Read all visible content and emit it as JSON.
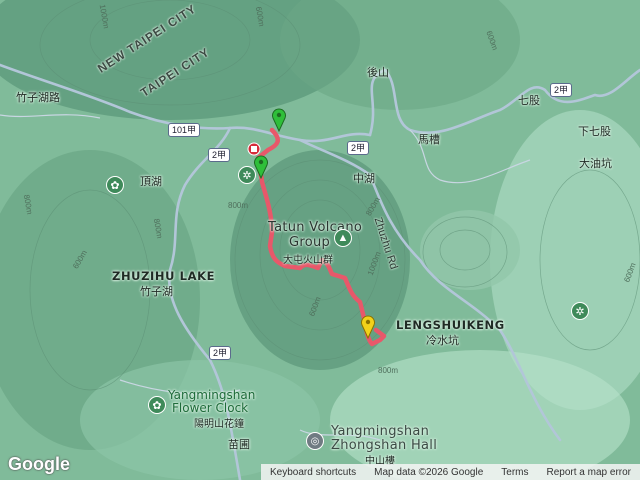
{
  "map": {
    "labels": {
      "new_taipei_city": "NEW TAIPEI CITY",
      "taipei_city": "TAIPEI CITY",
      "zhuzihu_rd": "竹子湖路",
      "road_101jia": "101甲",
      "road_2jia": "2甲",
      "houshan": "後山",
      "qigu": "七股",
      "xiaqigu": "下七股",
      "macao": "馬槽",
      "dayoukeng": "大油坑",
      "dinghu": "頂湖",
      "zhonghu": "中湖",
      "tatun_en_1": "Tatun Volcano",
      "tatun_en_2": "Group",
      "tatun_zh": "大屯火山群",
      "zhuzihu_lake_en": "ZHUZIHU LAKE",
      "zhuzihu_lake_zh": "竹子湖",
      "lengshuikeng_en": "LENGSHUIKENG",
      "lengshuikeng_zh": "冷水坑",
      "zhuzhu_rd": "Zhuzhu Rd",
      "flower_clock_en_1": "Yangmingshan",
      "flower_clock_en_2": "Flower Clock",
      "flower_clock_zh": "陽明山花鐘",
      "zhongshan_en_1": "Yangmingshan",
      "zhongshan_en_2": "Zhongshan Hall",
      "zhongshan_zh": "中山樓",
      "miaopu": "苗圃"
    },
    "elevations": [
      "1000m",
      "800m",
      "600m",
      "800m",
      "1000m",
      "800m",
      "600m",
      "600m",
      "600m",
      "800m",
      "800m",
      "600m"
    ],
    "route_color": "#e8586a",
    "marker_colors": {
      "start": "#2fbf3a",
      "end": "#f2d21a",
      "red": "#d62c3a"
    }
  },
  "footer": {
    "keyboard_shortcuts": "Keyboard shortcuts",
    "map_data": "Map data ©2026 Google",
    "terms": "Terms",
    "report": "Report a map error"
  },
  "logo": "Google"
}
